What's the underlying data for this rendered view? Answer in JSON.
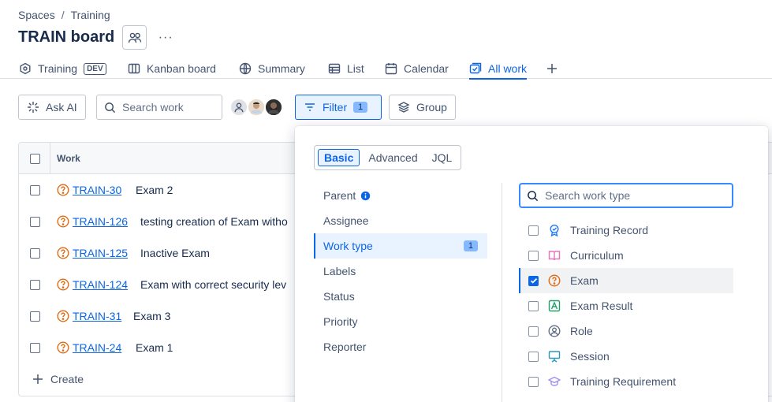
{
  "breadcrumb": {
    "spaces": "Spaces",
    "separator": "/",
    "training": "Training"
  },
  "board": {
    "title": "TRAIN board",
    "more": "···"
  },
  "tabs": [
    {
      "label": "Training",
      "badge": "DEV",
      "icon": "hexagon-icon"
    },
    {
      "label": "Kanban board",
      "icon": "board-icon"
    },
    {
      "label": "Summary",
      "icon": "globe-icon"
    },
    {
      "label": "List",
      "icon": "list-icon"
    },
    {
      "label": "Calendar",
      "icon": "calendar-icon"
    },
    {
      "label": "All work",
      "icon": "all-work-icon",
      "active": true
    }
  ],
  "toolbar": {
    "ask_ai": "Ask AI",
    "search_placeholder": "Search work",
    "filter": "Filter",
    "filter_count": "1",
    "group": "Group"
  },
  "table": {
    "column_work": "Work",
    "rows": [
      {
        "key": "TRAIN-30",
        "summary": "Exam 2"
      },
      {
        "key": "TRAIN-126",
        "summary": "testing creation of Exam witho"
      },
      {
        "key": "TRAIN-125",
        "summary": "Inactive Exam"
      },
      {
        "key": "TRAIN-124",
        "summary": "Exam with correct security lev"
      },
      {
        "key": "TRAIN-31",
        "summary": "Exam 3"
      },
      {
        "key": "TRAIN-24",
        "summary": "Exam 1"
      }
    ],
    "create": "Create"
  },
  "filter_panel": {
    "modes": [
      "Basic",
      "Advanced",
      "JQL"
    ],
    "fields": [
      {
        "label": "Parent",
        "info": true
      },
      {
        "label": "Assignee"
      },
      {
        "label": "Work type",
        "count": "1",
        "active": true
      },
      {
        "label": "Labels"
      },
      {
        "label": "Status"
      },
      {
        "label": "Priority"
      },
      {
        "label": "Reporter"
      }
    ],
    "search_placeholder": "Search work type",
    "options": [
      {
        "label": "Training Record",
        "checked": false,
        "icon": "badge-icon",
        "color": "#1d7afc"
      },
      {
        "label": "Curriculum",
        "checked": false,
        "icon": "book-icon",
        "color": "#e774bb"
      },
      {
        "label": "Exam",
        "checked": true,
        "icon": "question-icon",
        "color": "#e56910"
      },
      {
        "label": "Exam Result",
        "checked": false,
        "icon": "result-icon",
        "color": "#22a06b"
      },
      {
        "label": "Role",
        "checked": false,
        "icon": "person-icon",
        "color": "#626f86"
      },
      {
        "label": "Session",
        "checked": false,
        "icon": "presentation-icon",
        "color": "#2898bd"
      },
      {
        "label": "Training Requirement",
        "checked": false,
        "icon": "graduation-cap-icon",
        "color": "#9f8fef"
      }
    ]
  }
}
